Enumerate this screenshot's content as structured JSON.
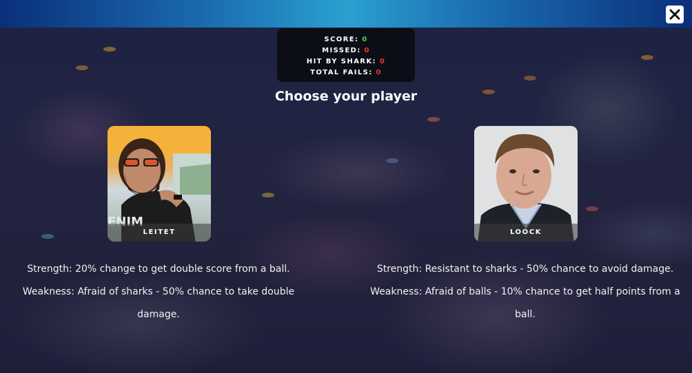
{
  "stats": {
    "score_label": "SCORE:",
    "score_value": "0",
    "missed_label": "MISSED:",
    "missed_value": "0",
    "hit_label": "HIT BY SHARK:",
    "hit_value": "0",
    "fails_label": "TOTAL FAILS:",
    "fails_value": "0"
  },
  "heading": "Choose your player",
  "players": [
    {
      "name": "LEITET",
      "strength": "Strength: 20% change to get double score from a ball.",
      "weakness": "Weakness: Afraid of sharks - 50% chance to take double damage."
    },
    {
      "name": "LOOCK",
      "strength": "Strength: Resistant to sharks - 50% chance to avoid damage.",
      "weakness": "Weakness: Afraid of balls - 10% chance to get half points from a ball."
    }
  ],
  "icons": {
    "close": "close-icon"
  },
  "colors": {
    "positive": "#35e04a",
    "negative": "#ff3030",
    "bar_accent": "#2aa0cf"
  }
}
